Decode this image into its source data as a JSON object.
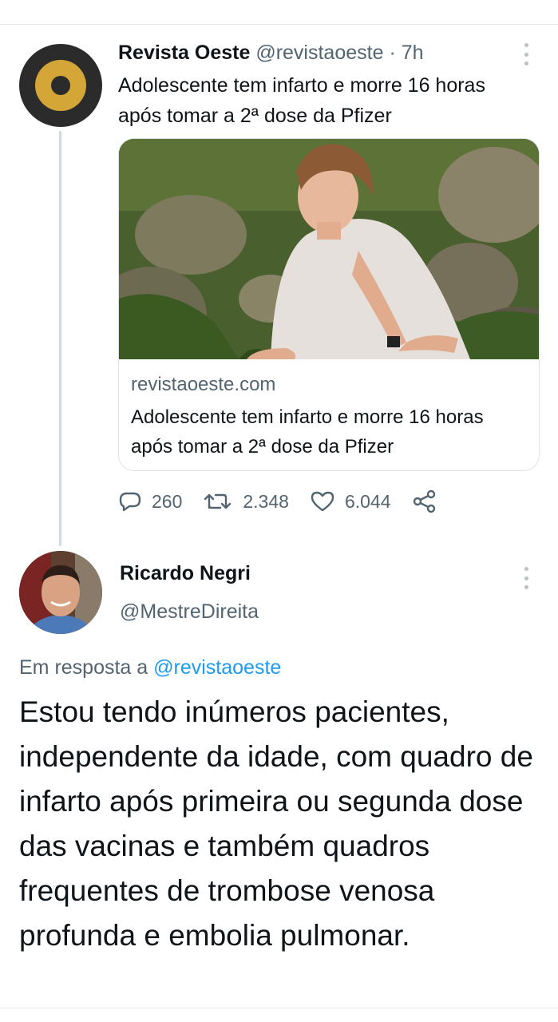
{
  "tweet": {
    "author_name": "Revista Oeste",
    "author_handle": "@revistaoeste",
    "time": "· 7h",
    "text": "Adolescente tem infarto e morre 16 horas após tomar a 2ª dose da Pfizer",
    "card": {
      "domain": "revistaoeste.com",
      "title": "Adolescente tem infarto e morre 16 horas após tomar a 2ª dose da Pfizer"
    },
    "stats": {
      "replies": "260",
      "retweets": "2.348",
      "likes": "6.044"
    }
  },
  "reply": {
    "author_name": "Ricardo Negri",
    "author_handle": "@MestreDireita",
    "reply_to_prefix": "Em resposta a",
    "reply_to_handle": "@revistaoeste",
    "text": "Estou tendo inúmeros pacientes, independente da idade, com quadro de infarto após primeira ou segunda dose das vacinas e também quadros frequentes de trombose venosa profunda e embolia pulmonar."
  },
  "colors": {
    "text": "#0f1419",
    "secondary": "#536471",
    "link": "#1d9bf0",
    "logo_gold": "#d4a537",
    "logo_dark": "#2b2b2b"
  },
  "icons": [
    "more-icon",
    "reply-icon",
    "retweet-icon",
    "like-icon",
    "share-icon"
  ]
}
